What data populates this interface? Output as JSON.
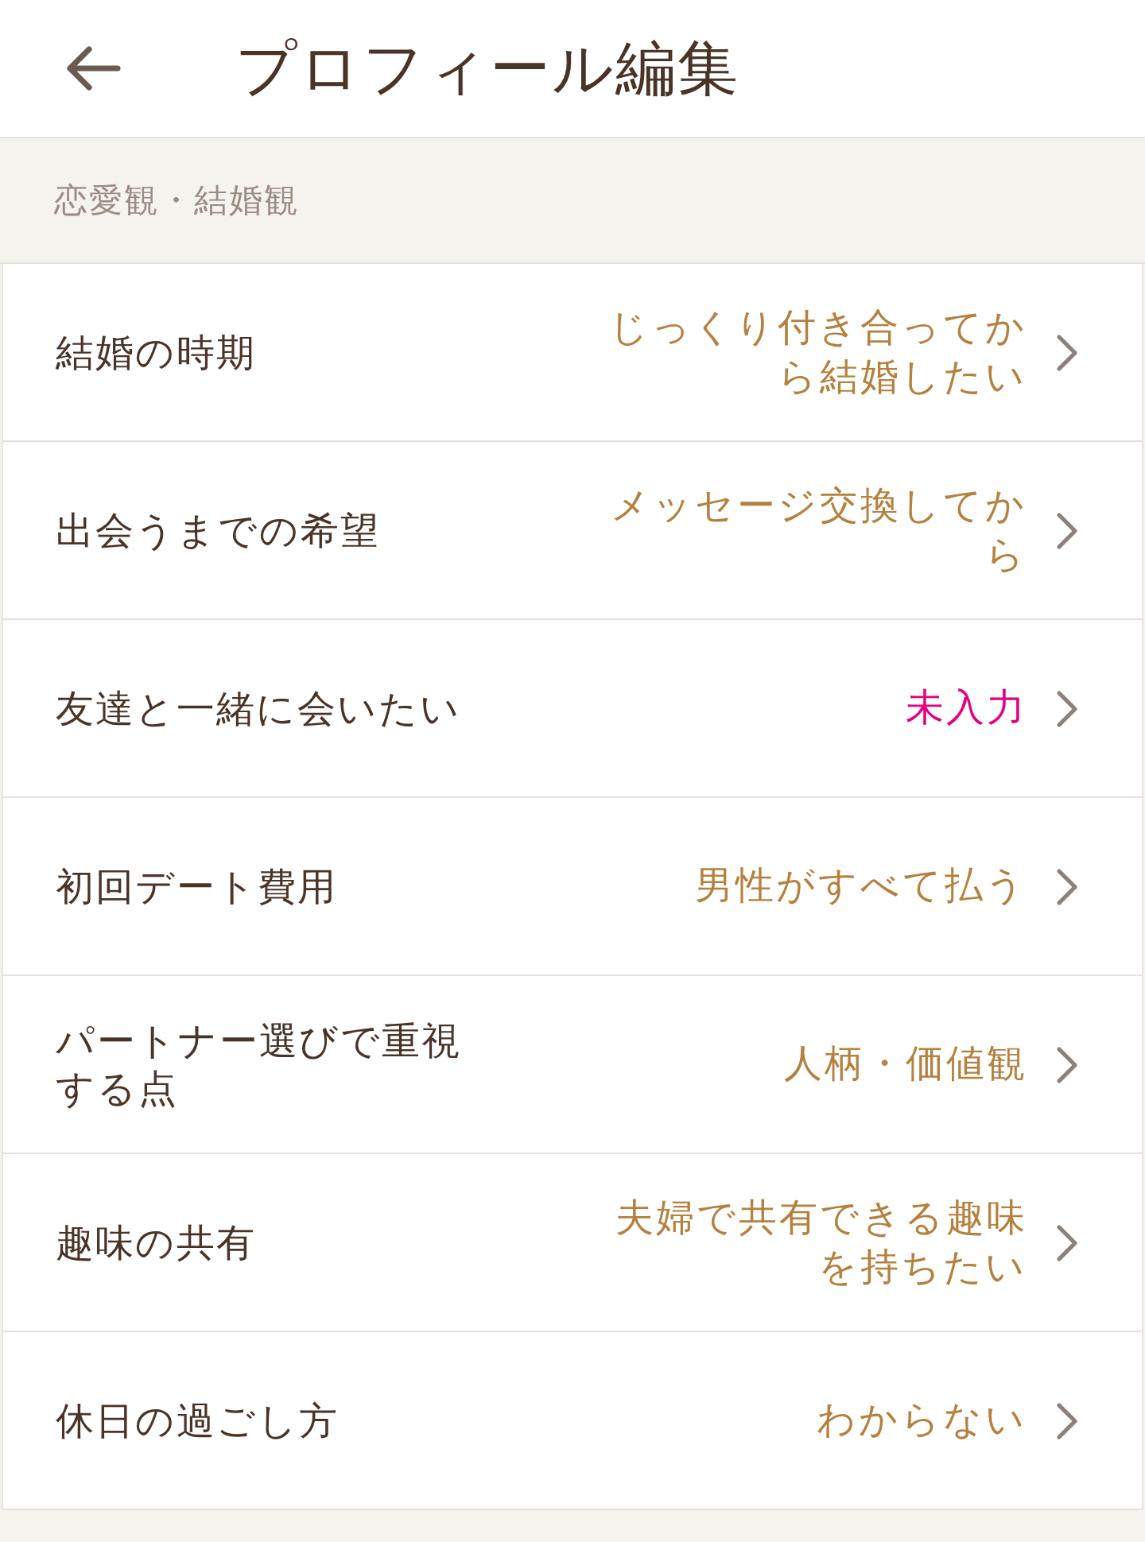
{
  "header": {
    "title": "プロフィール編集"
  },
  "section": {
    "title": "恋愛観・結婚観"
  },
  "rows": [
    {
      "label": "結婚の時期",
      "value": "じっくり付き合ってから結婚したい",
      "empty": false
    },
    {
      "label": "出会うまでの希望",
      "value": "メッセージ交換してから",
      "empty": false
    },
    {
      "label": "友達と一緒に会いたい",
      "value": "未入力",
      "empty": true
    },
    {
      "label": "初回デート費用",
      "value": "男性がすべて払う",
      "empty": false
    },
    {
      "label": "パートナー選びで重視する点",
      "value": "人柄・価値観",
      "empty": false
    },
    {
      "label": "趣味の共有",
      "value": "夫婦で共有できる趣味を持ちたい",
      "empty": false
    },
    {
      "label": "休日の過ごし方",
      "value": "わからない",
      "empty": false
    }
  ]
}
